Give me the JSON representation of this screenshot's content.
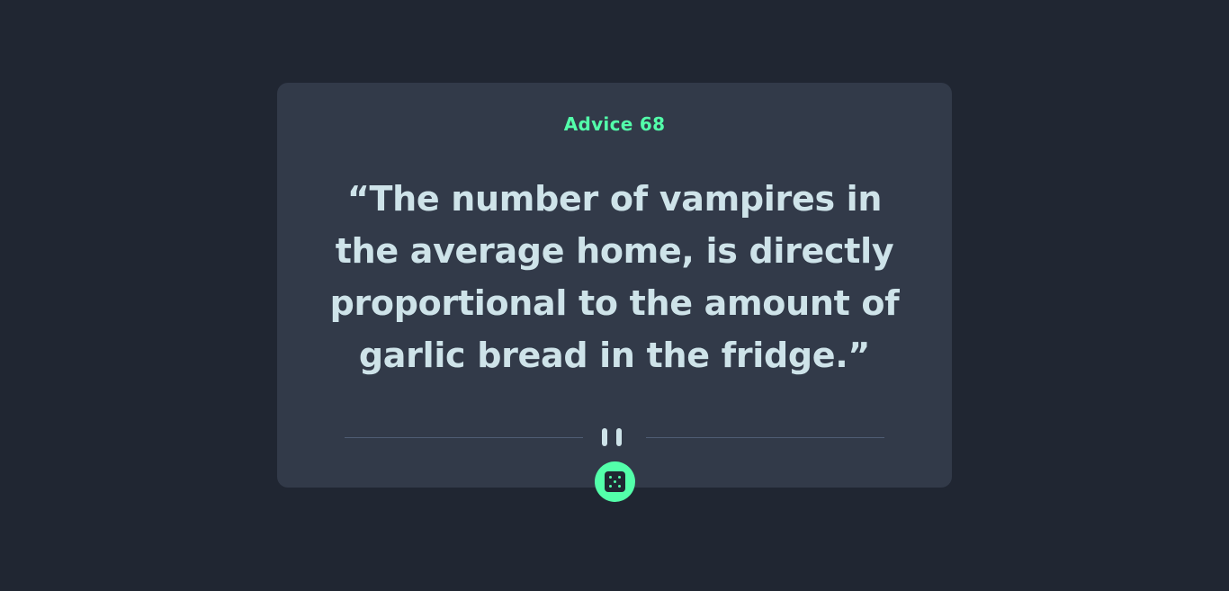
{
  "advice": {
    "title": "Advice 68",
    "quote": "“The number of vampires in the average home, is directly proportional to the amount of garlic bread in the fridge.”"
  },
  "colors": {
    "background": "#202632",
    "card": "#323a49",
    "accent": "#53ffaa",
    "text": "#cee3e9",
    "divider": "#4f5d74"
  },
  "icons": {
    "divider": "pause-icon",
    "button": "dice-icon"
  }
}
